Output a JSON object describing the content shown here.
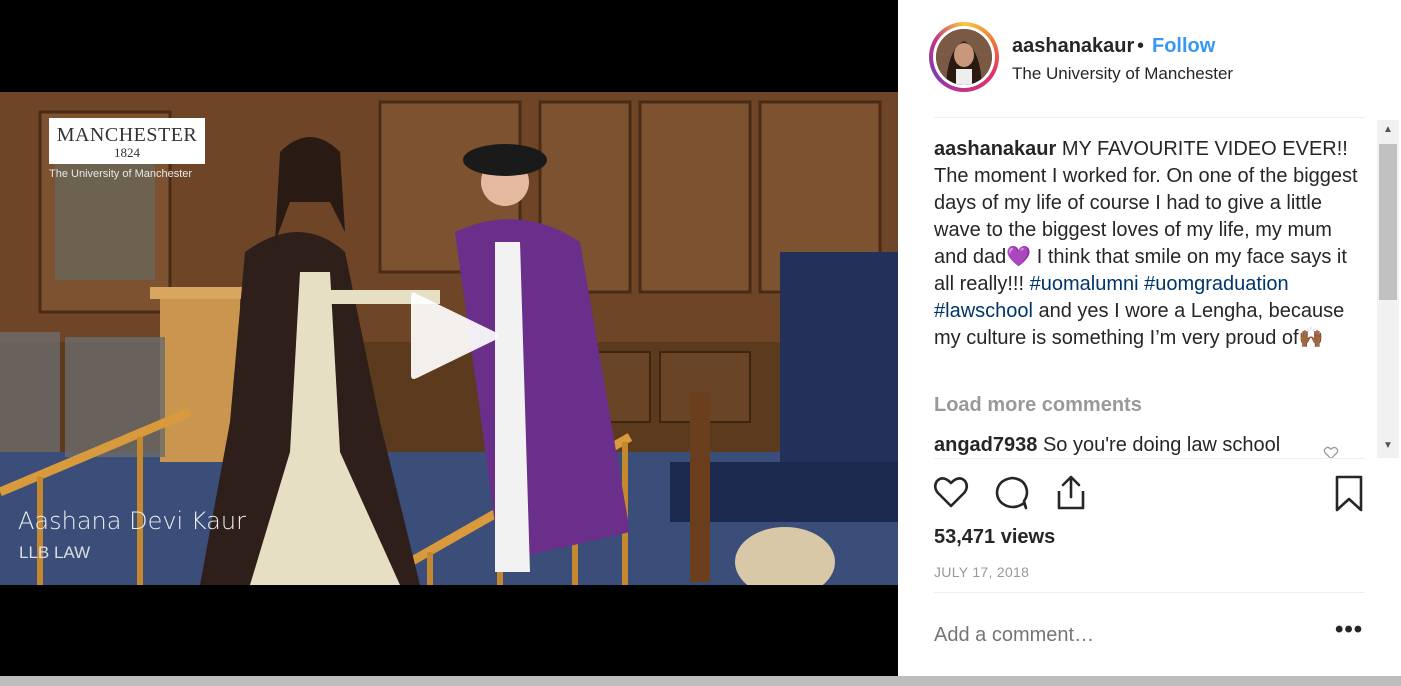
{
  "video": {
    "logo_main": "MANCHESTER",
    "logo_year": "1824",
    "logo_sub": "The University of Manchester",
    "caption_name": "Aashana Devi Kaur",
    "caption_sub": "LLB LAW"
  },
  "post": {
    "username": "aashanakaur",
    "separator": "•",
    "follow_label": "Follow",
    "location": "The University of Manchester",
    "caption": {
      "user": "aashanakaur",
      "text_1": " MY FAVOURITE VIDEO EVER!! The moment I worked for. On one of the biggest days of my life of course I had to give a little wave to the biggest loves of my life, my mum and dad",
      "emoji_1": "💜",
      "text_2": " I think that smile on my face says it all really!!! ",
      "hashtag_1": "#uomalumni",
      "hashtag_2": "#uomgraduation",
      "hashtag_3": "#lawschool",
      "text_3": " and yes I wore a Lengha, because my culture is something I’m very proud of",
      "emoji_2": "🙌🏾"
    },
    "load_more": "Load more comments",
    "comment_2": {
      "user": "angad7938",
      "text": "So you're doing law school"
    },
    "views": "53,471 views",
    "date": "JULY 17, 2018",
    "add_comment_placeholder": "Add a comment…",
    "more_label": "•••"
  },
  "icons": [
    "play-icon",
    "heart-icon",
    "comment-icon",
    "share-icon",
    "bookmark-icon",
    "small-heart-icon",
    "scroll-up-icon",
    "scroll-down-icon"
  ],
  "colors": {
    "follow": "#3897f0",
    "hashtag": "#003569",
    "muted": "#999999",
    "text": "#262626"
  }
}
